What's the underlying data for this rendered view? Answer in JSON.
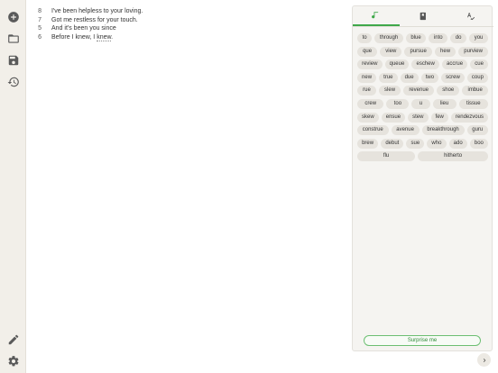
{
  "rail": {
    "top_icons": [
      "add-circle-icon",
      "folder-icon",
      "save-icon",
      "history-icon"
    ],
    "bottom_icons": [
      "pencil-icon",
      "gear-icon"
    ]
  },
  "lyrics": [
    {
      "num": "8",
      "text": "I've been helpless to your loving."
    },
    {
      "num": "7",
      "text": "Got me restless for your touch."
    },
    {
      "num": "5",
      "text": "And it's been you since"
    },
    {
      "num": "6",
      "text_a": "Before I knew, I ",
      "text_b": "knew",
      "text_c": "."
    }
  ],
  "panel": {
    "tabs": [
      {
        "icon": "rhyme-note-icon",
        "active": true
      },
      {
        "icon": "dictionary-book-icon",
        "active": false
      },
      {
        "icon": "spellcheck-icon",
        "active": false
      }
    ],
    "accent_color": "#3fa84a",
    "rows": [
      [
        "to",
        "through",
        "blue",
        "into",
        "do",
        "you"
      ],
      [
        "que",
        "view",
        "pursue",
        "hew",
        "purview"
      ],
      [
        "review",
        "queue",
        "eschew",
        "accrue",
        "cue"
      ],
      [
        "new",
        "true",
        "due",
        "two",
        "screw",
        "coup"
      ],
      [
        "rue",
        "slew",
        "revenue",
        "shoe",
        "imbue"
      ],
      [
        "crew",
        "too",
        "u",
        "lieu",
        "tissue"
      ],
      [
        "skew",
        "ensue",
        "stew",
        "few",
        "rendezvous"
      ],
      [
        "construe",
        "avenue",
        "breakthrough",
        "guru"
      ],
      [
        "brew",
        "debut",
        "sue",
        "who",
        "ado",
        "boo"
      ],
      [
        "flu",
        "hitherto"
      ]
    ],
    "surprise_label": "Surprise me"
  }
}
